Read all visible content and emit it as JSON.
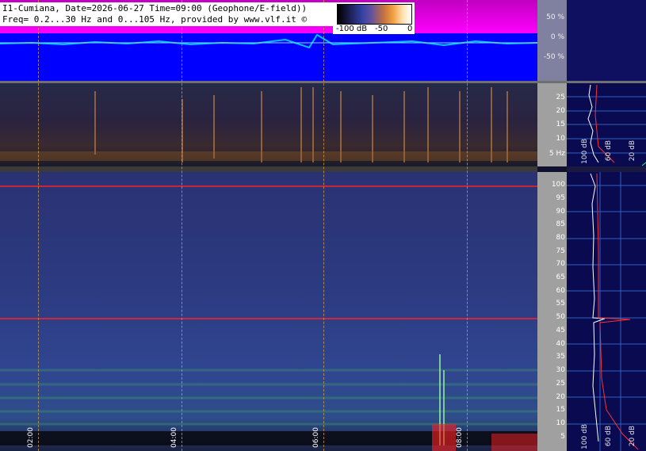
{
  "header": {
    "line1": "I1-Cumiana, Date=2026-06-27 Time=09:00 (Geophone/E-field))",
    "line2": "Freq= 0.2...30 Hz and 0...105 Hz, provided by www.vlf.it ©"
  },
  "colorbar": {
    "min_label": "-100 dB",
    "mid_label": "-50",
    "max_label": "0"
  },
  "wave_scale": [
    "50 %",
    "0 %",
    "-50 %"
  ],
  "low_band_ticks": [
    "25",
    "20",
    "15",
    "10",
    "5 Hz"
  ],
  "high_band_ticks": [
    "100",
    "95",
    "90",
    "85",
    "80",
    "75",
    "70",
    "65",
    "60",
    "55",
    "50",
    "45",
    "40",
    "35",
    "30",
    "25",
    "20",
    "15",
    "10",
    "5"
  ],
  "time_labels": [
    "02:00",
    "04:00",
    "06:00",
    "08:00"
  ],
  "profile_low_labels": [
    "100 dB",
    "60 dB",
    "20 dB"
  ],
  "profile_high_labels": [
    "100 dB",
    "60 dB",
    "20 dB"
  ],
  "colors": {
    "wave_bg": "#0000ff",
    "wave_top": "#ff00ff",
    "trace": "#00c0ff",
    "hline_50": "#ff2020",
    "hline_100": "#ff2020",
    "dash": "#d8a040"
  }
}
